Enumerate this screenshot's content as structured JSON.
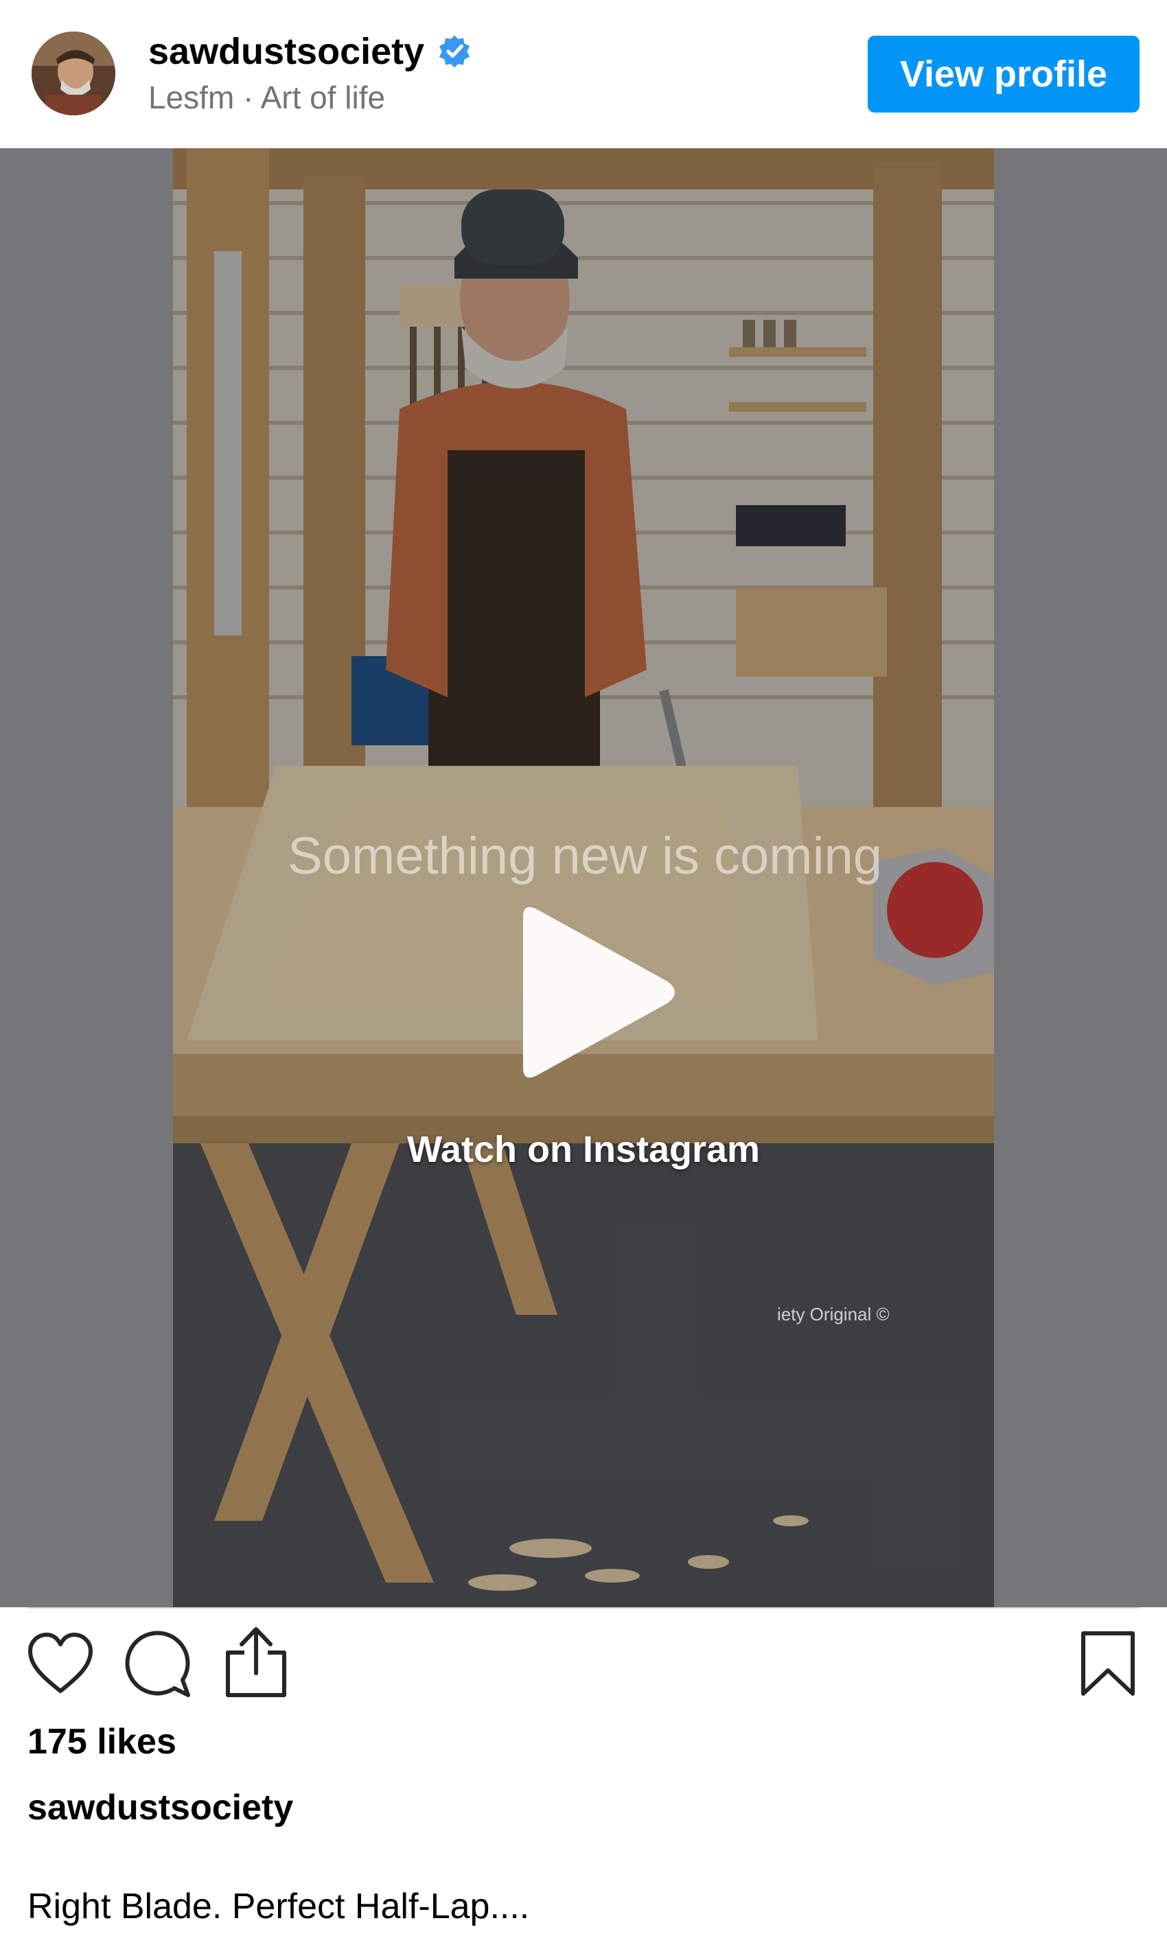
{
  "header": {
    "username": "sawdustsociety",
    "verified": true,
    "subtitle": "Lesfm · Art of life",
    "view_profile_label": "View profile"
  },
  "media": {
    "overlay_text": "Something new is coming",
    "watermark": "iety Original ©",
    "watch_label": "Watch on Instagram"
  },
  "actions": {
    "icons": [
      "heart-icon",
      "comment-icon",
      "share-icon",
      "bookmark-icon"
    ]
  },
  "post": {
    "likes": "175 likes",
    "caption_user": "sawdustsociety",
    "caption_text": "Right Blade. Perfect Half-Lap...."
  },
  "colors": {
    "accent": "#0095f6",
    "subtext": "#737373",
    "media_background": "#75767a",
    "divider": "#dbdbdb"
  }
}
